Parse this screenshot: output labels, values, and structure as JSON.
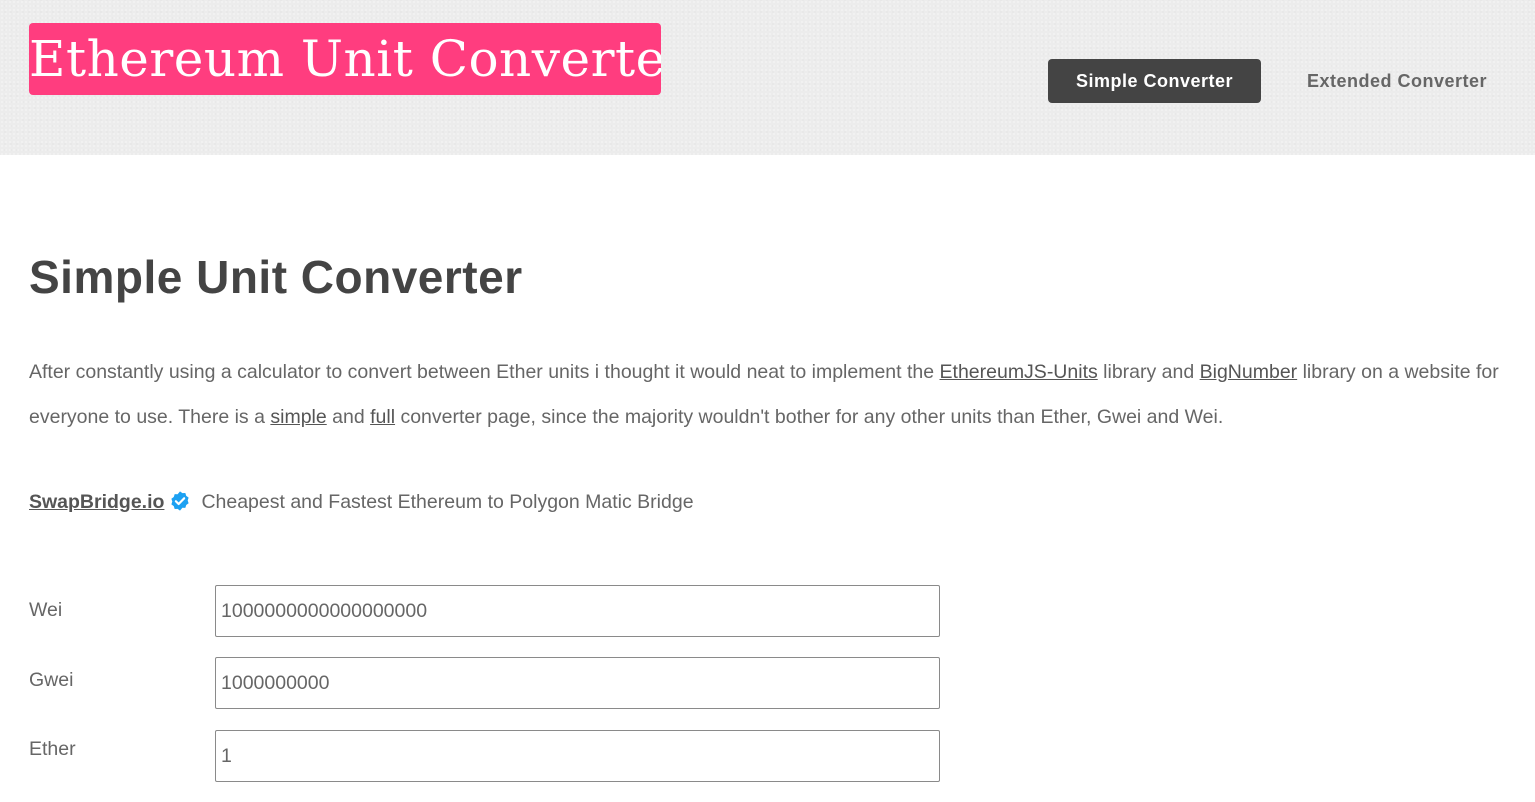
{
  "header": {
    "logo_text": "Ethereum Unit Converter",
    "nav": {
      "simple_label": "Simple Converter",
      "extended_label": "Extended Converter"
    }
  },
  "main": {
    "title": "Simple Unit Converter",
    "intro": {
      "part1": "After constantly using a calculator to convert between Ether units i thought it would neat to implement the ",
      "link_ethereumjs": "EthereumJS-Units",
      "part2": " library and ",
      "link_bignumber": "BigNumber",
      "part3": " library on a website for everyone to use. There is a ",
      "link_simple": "simple",
      "part4": " and ",
      "link_full": "full",
      "part5": " converter page, since the majority wouldn't bother for any other units than Ether, Gwei and Wei."
    },
    "promo": {
      "brand": "SwapBridge.io",
      "verified_icon": "verified-badge-icon",
      "verified_color": "#1da1f2",
      "tagline": "Cheapest and Fastest Ethereum to Polygon Matic Bridge"
    },
    "fields": [
      {
        "label": "Wei",
        "value": "1000000000000000000"
      },
      {
        "label": "Gwei",
        "value": "1000000000"
      },
      {
        "label": "Ether",
        "value": "1"
      }
    ]
  },
  "colors": {
    "logo_bg": "#ff3d7f",
    "nav_active_bg": "#444444",
    "header_bg": "#ececec",
    "text": "#666666",
    "heading": "#444444"
  }
}
